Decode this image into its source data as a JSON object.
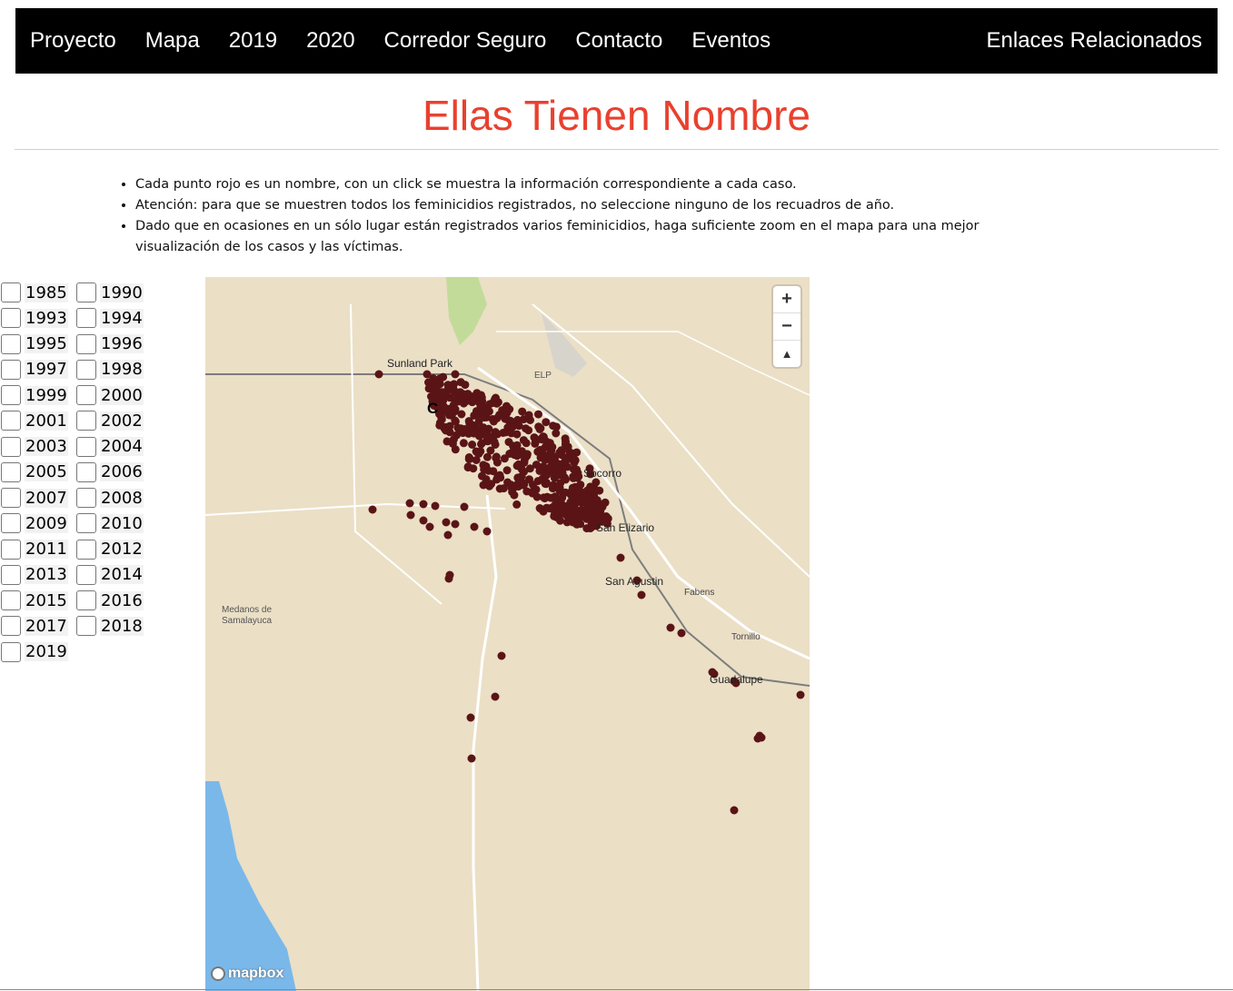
{
  "nav": {
    "items": [
      "Proyecto",
      "Mapa",
      "2019",
      "2020",
      "Corredor Seguro",
      "Contacto",
      "Eventos"
    ],
    "right": "Enlaces Relacionados"
  },
  "title": "Ellas Tienen Nombre",
  "notes": [
    "Cada punto rojo es un nombre, con un click se muestra la información correspondiente a cada caso.",
    "Atención: para que se muestren todos los feminicidios registrados, no seleccione ninguno de los recuadros de año.",
    "Dado que en ocasiones en un sólo lugar están registrados varios feminicidios, haga suficiente zoom en el mapa para una mejor visualización de los casos y las víctimas."
  ],
  "years": [
    "1985",
    "1990",
    "1993",
    "1994",
    "1995",
    "1996",
    "1997",
    "1998",
    "1999",
    "2000",
    "2001",
    "2002",
    "2003",
    "2004",
    "2005",
    "2006",
    "2007",
    "2008",
    "2009",
    "2010",
    "2011",
    "2012",
    "2013",
    "2014",
    "2015",
    "2016",
    "2017",
    "2018",
    "2019"
  ],
  "map": {
    "places": [
      "Sunland Park",
      "ELP",
      "Socorro",
      "San Elizario",
      "San Agustin",
      "Fabens",
      "Tornillo",
      "Guadalupe",
      "Medanos de",
      "Samalayuca"
    ],
    "city_label_partial": "C",
    "attribution": "mapbox",
    "zoom_in": "+",
    "zoom_out": "−",
    "compass": "▲",
    "colors": {
      "land": "#ebdfc6",
      "water": "#7ab8ea",
      "dot": "#5a1416",
      "road": "#ffffff",
      "park": "#b9d98d"
    }
  }
}
